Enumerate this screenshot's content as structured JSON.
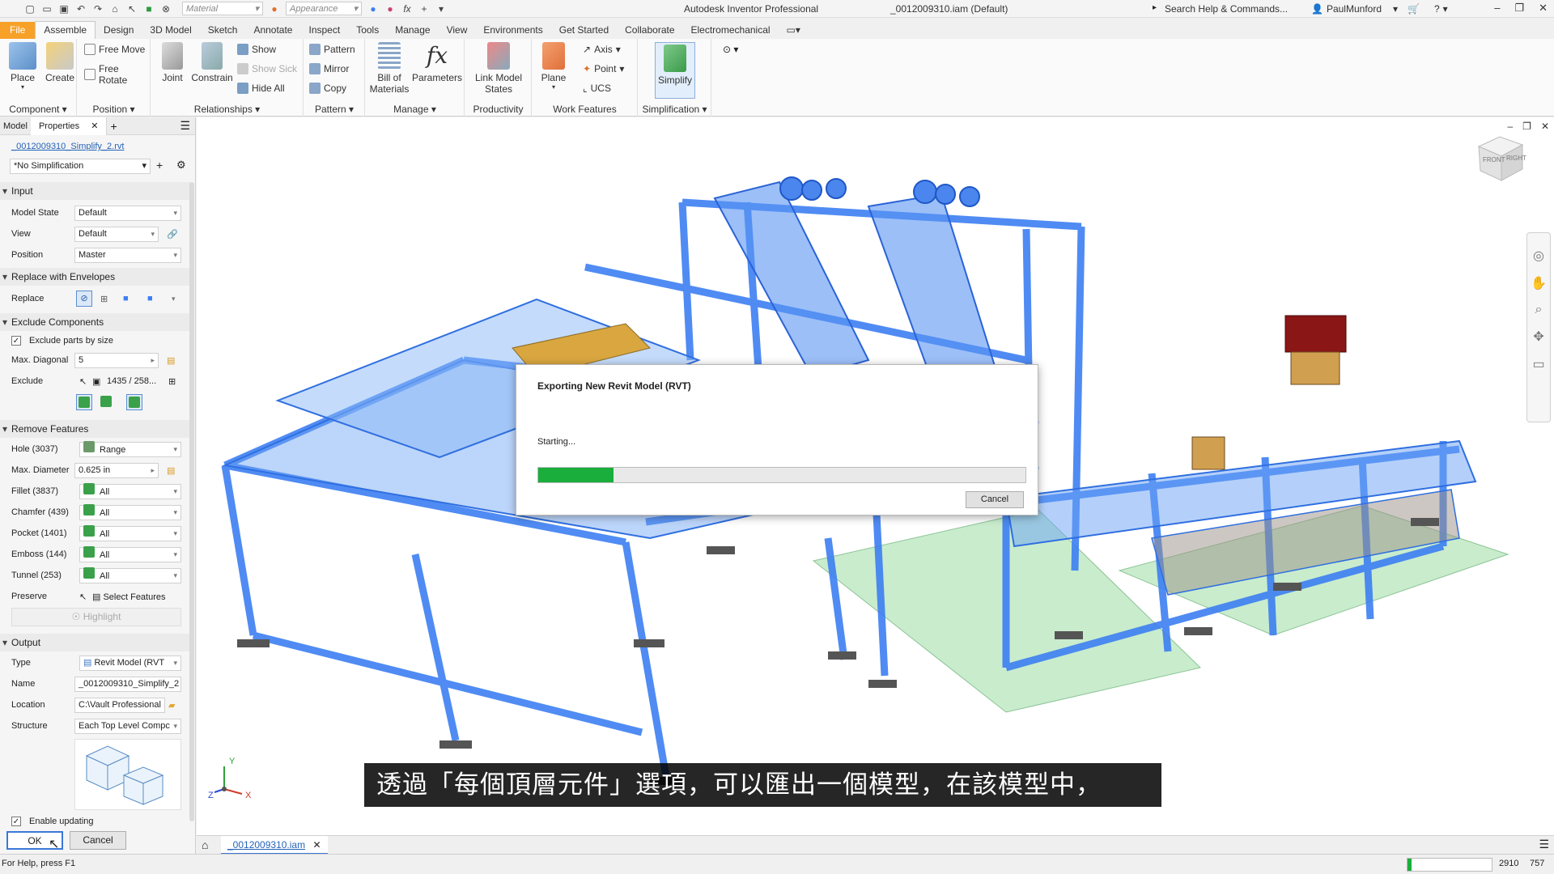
{
  "titlebar": {
    "app_title": "Autodesk Inventor Professional",
    "doc_title": "_0012009310.iam (Default)",
    "material_placeholder": "Material",
    "appearance_placeholder": "Appearance",
    "search_text": "Search Help & Commands...",
    "user": "PaulMunford"
  },
  "tabs": [
    "File",
    "Assemble",
    "Design",
    "3D Model",
    "Sketch",
    "Annotate",
    "Inspect",
    "Tools",
    "Manage",
    "View",
    "Environments",
    "Get Started",
    "Collaborate",
    "Electromechanical"
  ],
  "ribbon": {
    "component": {
      "title": "Component",
      "place": "Place",
      "create": "Create"
    },
    "position": {
      "title": "Position",
      "free_move": "Free Move",
      "free_rotate": "Free Rotate"
    },
    "relationships": {
      "title": "Relationships",
      "joint": "Joint",
      "constrain": "Constrain",
      "show": "Show",
      "show_sick": "Show Sick",
      "hide_all": "Hide All"
    },
    "pattern": {
      "title": "Pattern",
      "pattern": "Pattern",
      "mirror": "Mirror",
      "copy": "Copy"
    },
    "manage": {
      "title": "Manage",
      "bom_line1": "Bill of",
      "bom_line2": "Materials",
      "parameters": "Parameters"
    },
    "productivity": {
      "title": "Productivity",
      "link_line1": "Link Model",
      "link_line2": "States"
    },
    "work_features": {
      "title": "Work Features",
      "plane": "Plane",
      "axis": "Axis",
      "point": "Point",
      "ucs": "UCS"
    },
    "simplification": {
      "title": "Simplification",
      "simplify": "Simplify"
    }
  },
  "panel": {
    "tab_model": "Model",
    "tab_properties": "Properties",
    "file_link": "_0012009310_Simplify_2.rvt",
    "simplification_select": "*No Simplification",
    "input": {
      "title": "Input",
      "model_state_label": "Model State",
      "model_state": "Default",
      "view_label": "View",
      "view": "Default",
      "position_label": "Position",
      "position": "Master"
    },
    "envelopes": {
      "title": "Replace with Envelopes",
      "replace_label": "Replace"
    },
    "exclude": {
      "title": "Exclude Components",
      "by_size_label": "Exclude parts by size",
      "max_diag_label": "Max. Diagonal",
      "max_diag": "5",
      "exclude_label": "Exclude",
      "exclude_value": "1435 / 258..."
    },
    "features": {
      "title": "Remove Features",
      "hole_label": "Hole (3037)",
      "hole": "Range",
      "max_diam_label": "Max. Diameter",
      "max_diam": "0.625 in",
      "fillet_label": "Fillet (3837)",
      "fillet": "All",
      "chamfer_label": "Chamfer (439)",
      "chamfer": "All",
      "pocket_label": "Pocket (1401)",
      "pocket": "All",
      "emboss_label": "Emboss (144)",
      "emboss": "All",
      "tunnel_label": "Tunnel (253)",
      "tunnel": "All",
      "preserve_label": "Preserve",
      "preserve": "Select Features",
      "highlight": "Highlight"
    },
    "output": {
      "title": "Output",
      "type_label": "Type",
      "type": "Revit Model (RVT",
      "name_label": "Name",
      "name": "_0012009310_Simplify_2",
      "location_label": "Location",
      "location": "C:\\Vault Professional",
      "structure_label": "Structure",
      "structure": "Each Top Level Compc"
    },
    "enable_updating": "Enable updating",
    "ok": "OK",
    "cancel": "Cancel"
  },
  "dialog": {
    "title": "Exporting New Revit Model (RVT)",
    "status": "Starting...",
    "progress": 0.155,
    "cancel": "Cancel"
  },
  "viewcube": {
    "front": "FRONT",
    "right": "RIGHT"
  },
  "triad": {
    "x": "X",
    "y": "Y",
    "z": "Z"
  },
  "subtitle": "透過「每個頂層元件」選項，可以匯出一個模型，在該模型中，",
  "doc_tab": "_0012009310.iam",
  "status": {
    "help": "For Help, press F1",
    "count1": "2910",
    "count2": "757"
  },
  "colors": {
    "accent_file": "#f7a128",
    "model_blue": "#3d7ff2",
    "progress_green": "#1aae3c"
  }
}
